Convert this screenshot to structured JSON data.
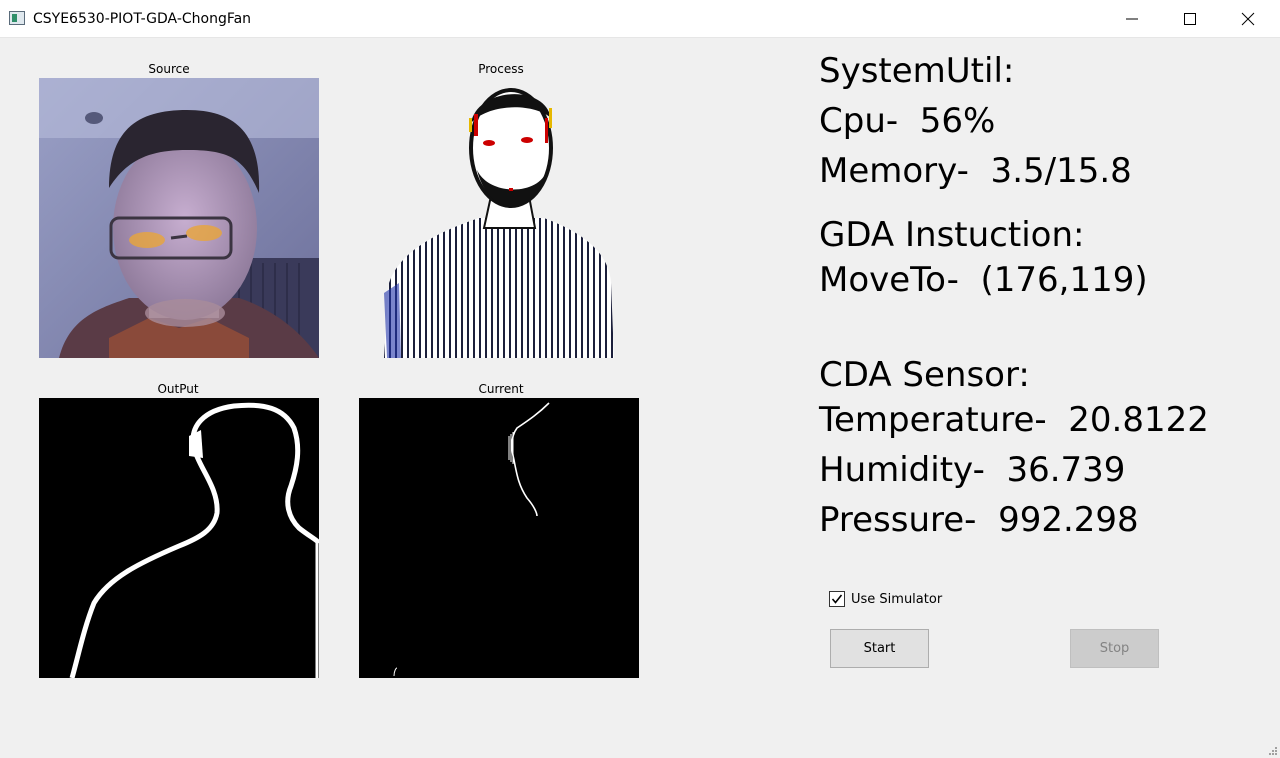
{
  "window": {
    "title": "CSYE6530-PIOT-GDA-ChongFan",
    "controls": {
      "minimize": "minimize-icon",
      "maximize": "maximize-icon",
      "close": "close-icon"
    }
  },
  "panes": {
    "source": "Source",
    "process": "Process",
    "output": "OutPut",
    "current": "Current"
  },
  "system_util": {
    "title": "SystemUtil:",
    "cpu": "Cpu-  56%",
    "memory": "Memory-  3.5/15.8"
  },
  "gda": {
    "title": "GDA Instuction:",
    "move_to": "MoveTo-  (176,119)"
  },
  "cda": {
    "title": "CDA Sensor:",
    "temperature": "Temperature-  20.8122",
    "humidity": "Humidity-  36.739",
    "pressure": "Pressure-  992.298"
  },
  "controls": {
    "use_simulator_label": "Use Simulator",
    "use_simulator_checked": true,
    "start_label": "Start",
    "stop_label": "Stop",
    "stop_enabled": false
  }
}
